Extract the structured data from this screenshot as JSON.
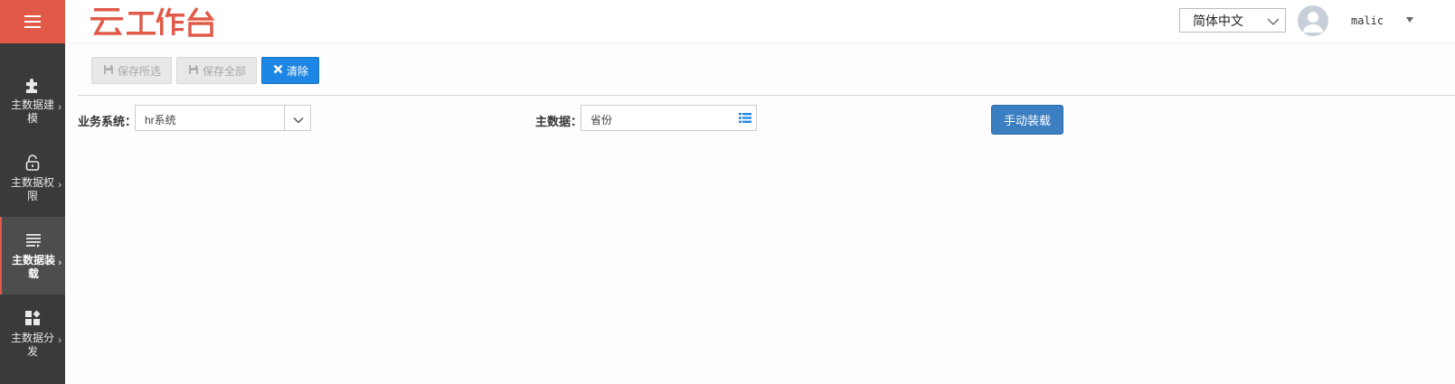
{
  "header": {
    "logo_text": "云工作台",
    "language": "简体中文",
    "username": "malic"
  },
  "sidebar": {
    "items": [
      {
        "label": "主数据建模",
        "icon": "puzzle-icon"
      },
      {
        "label": "主数据权限",
        "icon": "lock-icon"
      },
      {
        "label": "主数据装载",
        "icon": "list-load-icon",
        "active": true
      },
      {
        "label": "主数据分发",
        "icon": "grid-share-icon"
      }
    ]
  },
  "toolbar": {
    "save_selected_label": "保存所选",
    "save_all_label": "保存全部",
    "clear_label": "清除"
  },
  "form": {
    "business_system_label": "业务系统：",
    "business_system_value": "hr系统",
    "master_data_label": "主数据：",
    "master_data_value": "省份",
    "manual_load_label": "手动装载"
  },
  "colors": {
    "brand_red": "#e05a47",
    "sidebar_bg": "#3a3a3a",
    "primary_blue": "#1e87e5",
    "load_button_blue": "#3b7ec2"
  }
}
